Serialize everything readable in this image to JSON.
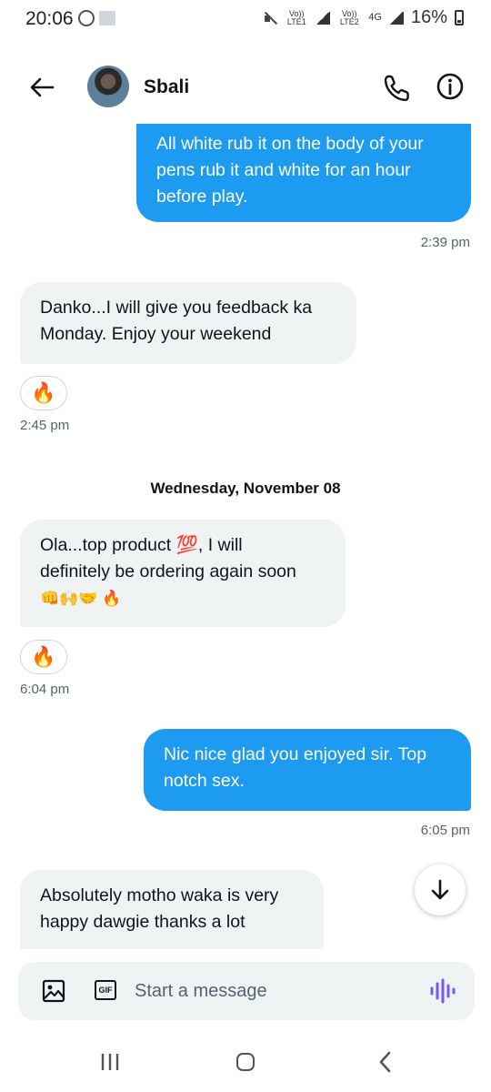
{
  "status_bar": {
    "time": "20:06",
    "sim1": "Vo)) LTE1",
    "sim2": "Vo)) LTE2",
    "network": "4G",
    "battery": "16%"
  },
  "header": {
    "contact_name": "Sbali"
  },
  "messages": [
    {
      "direction": "outgoing",
      "lines": [
        "All white rub it on the body of your",
        "pens rub it and white for an hour",
        "before play."
      ],
      "time": "2:39 pm"
    },
    {
      "direction": "incoming",
      "lines": [
        "Danko...I will give you feedback ka",
        "Monday. Enjoy your weekend"
      ],
      "reaction": "🔥",
      "time": "2:45 pm"
    },
    {
      "direction": "incoming",
      "lines": [
        "Ola...top product 💯, I will",
        "definitely be ordering again soon",
        "👊🙌🤝 🔥"
      ],
      "reaction": "🔥",
      "time": "6:04 pm"
    },
    {
      "direction": "outgoing",
      "lines": [
        "Nic nice glad you enjoyed sir. Top",
        "notch sex."
      ],
      "time": "6:05 pm"
    },
    {
      "direction": "incoming",
      "lines": [
        "Absolutely motho waka is very",
        "happy dawgie thanks a lot"
      ]
    }
  ],
  "date_separator": "Wednesday, November 08",
  "composer": {
    "placeholder": "Start a message",
    "gif_label": "GIF"
  },
  "colors": {
    "outgoing_bubble": "#1d9bf0",
    "incoming_bubble": "#eff3f4",
    "voice_accent": "#7856ff"
  },
  "icons": [
    "back-arrow-icon",
    "phone-icon",
    "info-icon",
    "image-icon",
    "gif-icon",
    "voice-icon",
    "scroll-down-icon",
    "recent-apps-icon",
    "home-icon",
    "nav-back-icon"
  ]
}
